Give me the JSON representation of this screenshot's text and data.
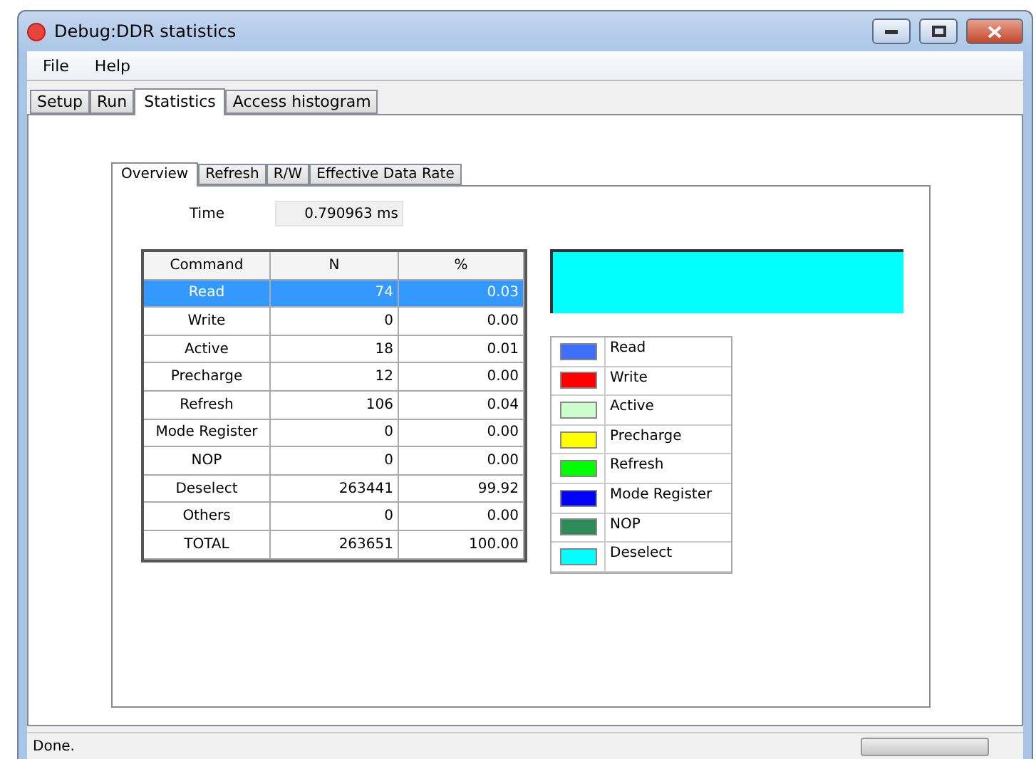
{
  "window": {
    "title": "Debug:DDR statistics"
  },
  "menu": [
    "File",
    "Help"
  ],
  "tabs": [
    {
      "label": "Setup",
      "selected": false
    },
    {
      "label": "Run",
      "selected": false
    },
    {
      "label": "Statistics",
      "selected": true
    },
    {
      "label": "Access histogram",
      "selected": false
    }
  ],
  "subtabs": [
    {
      "label": "Overview",
      "selected": true
    },
    {
      "label": "Refresh",
      "selected": false
    },
    {
      "label": "R/W",
      "selected": false
    },
    {
      "label": "Effective Data Rate",
      "selected": false
    }
  ],
  "time": {
    "label": "Time",
    "value": "0.790963 ms"
  },
  "table": {
    "columns": [
      "Command",
      "N",
      "%"
    ],
    "rows": [
      {
        "cells": [
          "Read",
          "74",
          "0.03"
        ],
        "selected": true
      },
      {
        "cells": [
          "Write",
          "0",
          "0.00"
        ],
        "selected": false
      },
      {
        "cells": [
          "Active",
          "18",
          "0.01"
        ],
        "selected": false
      },
      {
        "cells": [
          "Precharge",
          "12",
          "0.00"
        ],
        "selected": false
      },
      {
        "cells": [
          "Refresh",
          "106",
          "0.04"
        ],
        "selected": false
      },
      {
        "cells": [
          "Mode Register",
          "0",
          "0.00"
        ],
        "selected": false
      },
      {
        "cells": [
          "NOP",
          "0",
          "0.00"
        ],
        "selected": false
      },
      {
        "cells": [
          "Deselect",
          "263441",
          "99.92"
        ],
        "selected": false
      },
      {
        "cells": [
          "Others",
          "0",
          "0.00"
        ],
        "selected": false
      },
      {
        "cells": [
          "TOTAL",
          "263651",
          "100.00"
        ],
        "selected": false
      }
    ]
  },
  "legend": [
    {
      "label": "Read",
      "color": "#3f6fff"
    },
    {
      "label": "Write",
      "color": "#ff0000"
    },
    {
      "label": "Active",
      "color": "#ccffcc"
    },
    {
      "label": "Precharge",
      "color": "#ffff00"
    },
    {
      "label": "Refresh",
      "color": "#00ff00"
    },
    {
      "label": "Mode Register",
      "color": "#0000ff"
    },
    {
      "label": "NOP",
      "color": "#2e8b57"
    },
    {
      "label": "Deselect",
      "color": "#00ffff"
    }
  ],
  "status_bar": {
    "text": "Done.",
    "progress": {
      "level": 0
    }
  }
}
